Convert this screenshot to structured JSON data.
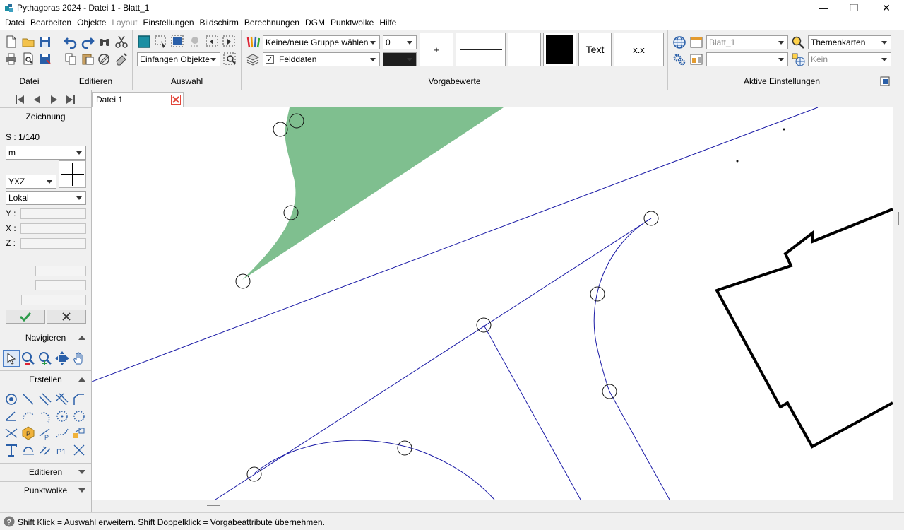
{
  "window": {
    "title": "Pythagoras 2024 - Datei 1 - Blatt_1",
    "minimize_glyph": "—",
    "maximize_glyph": "❐",
    "close_glyph": "✕"
  },
  "menu": {
    "items": [
      "Datei",
      "Bearbeiten",
      "Objekte",
      "Layout",
      "Einstellungen",
      "Bildschirm",
      "Berechnungen",
      "DGM",
      "Punktwolke",
      "Hilfe"
    ],
    "disabled": [
      "Layout"
    ]
  },
  "ribbon": {
    "groups": {
      "datei": "Datei",
      "editieren": "Editieren",
      "auswahl": "Auswahl",
      "vorgabewerte": "Vorgabewerte",
      "aktive": "Aktive Einstellungen"
    },
    "auswahl_mode": "Einfangen Objekte",
    "group_select": "Keine/neue Gruppe wählen",
    "layer_select": "Felddaten",
    "layer_checked": true,
    "line_width_value": "0",
    "point_symbol": "+",
    "text_label": "Text",
    "number_format": "x.x",
    "sheet_select": "Blatt_1",
    "sheet_select_2": "",
    "theme_select": "Themenkarten",
    "theme_select_2": "Kein",
    "color_fill": "#000000"
  },
  "leftpanel": {
    "section_title": "Zeichnung",
    "scale": "S : 1/140",
    "unit": "m",
    "axis_order": "YXZ",
    "coord_system": "Lokal",
    "y_label": "Y :",
    "x_label": "X :",
    "z_label": "Z :",
    "navigieren": "Navigieren",
    "erstellen": "Erstellen",
    "editieren": "Editieren",
    "punktwolke": "Punktwolke"
  },
  "tabs": {
    "doc_tab": "Datei 1"
  },
  "status": {
    "hint": "Shift Klick = Auswahl erweitern. Shift Doppelklick = Vorgabeattribute übernehmen."
  },
  "colors": {
    "accent_teal": "#1b8fa3",
    "line_blue": "#1a1aa6",
    "fill_green": "#7fbf8f",
    "close_red": "#e2463a"
  }
}
